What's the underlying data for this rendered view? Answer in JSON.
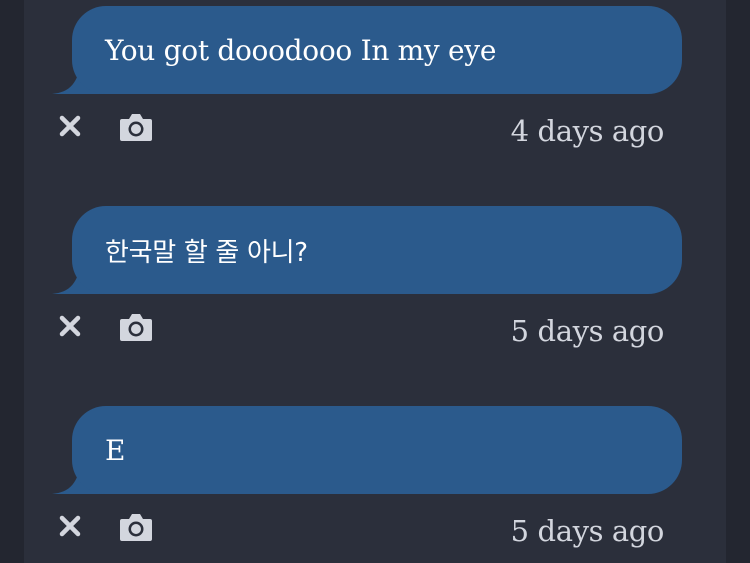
{
  "messages": [
    {
      "text": "You got dooodooo In my eye",
      "time": "4 days ago"
    },
    {
      "text": "한국말 할 줄 아니?",
      "time": "5 days ago"
    },
    {
      "text": "E",
      "time": "5 days ago"
    }
  ],
  "icons": {
    "delete": "close-icon",
    "camera": "camera-icon"
  },
  "colors": {
    "background": "#232630",
    "panel": "#2b2f3b",
    "bubble": "#2b5a8c",
    "text": "#ffffff",
    "muted": "#d3d6de"
  }
}
